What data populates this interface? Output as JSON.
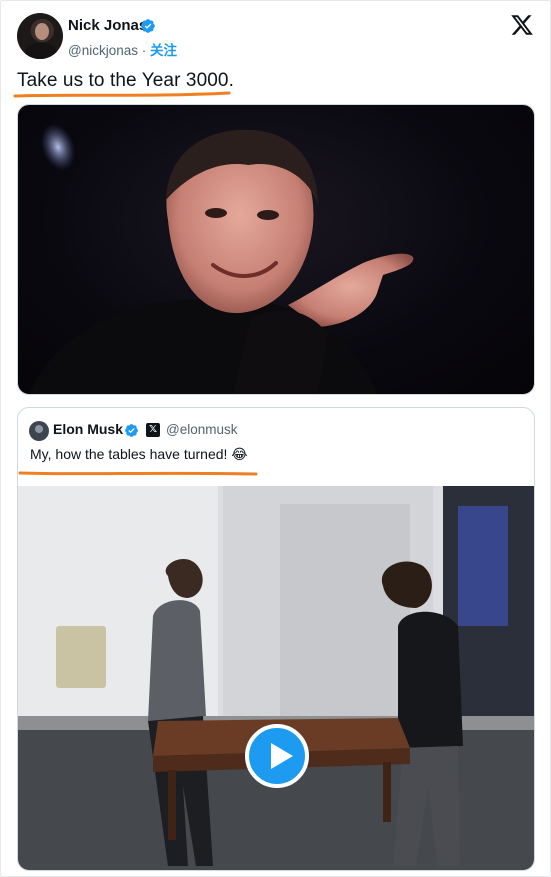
{
  "tweet": {
    "author_name": "Nick Jonas",
    "author_handle": "@nickjonas",
    "separator": " · ",
    "follow_label": "关注",
    "text": "Take us to the Year 3000.",
    "verified_icon": "verified-badge-icon",
    "platform_icon": "x-logo-icon"
  },
  "quoted": {
    "author_name": "Elon Musk",
    "author_handle": "@elonmusk",
    "affiliation_badge": "𝕏",
    "text": "My, how the tables have turned! 😂",
    "video_icon": "play-icon"
  },
  "colors": {
    "accent": "#1d9bf0",
    "underline": "#f07f22",
    "text": "#0f1419",
    "secondary": "#536471"
  }
}
